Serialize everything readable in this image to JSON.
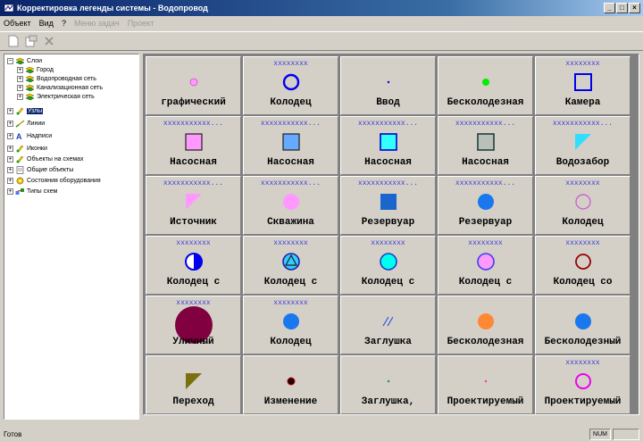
{
  "window": {
    "title": "Корректировка легенды системы - Водопровод",
    "minimize": "_",
    "maximize": "□",
    "close": "×"
  },
  "menu": [
    {
      "label": "Объект",
      "disabled": false
    },
    {
      "label": "Вид",
      "disabled": false
    },
    {
      "label": "?",
      "disabled": false
    },
    {
      "label": "Меню задач",
      "disabled": true
    },
    {
      "label": "Проект",
      "disabled": true
    }
  ],
  "tree": [
    {
      "label": "Слои",
      "level": 0,
      "expander": "−",
      "icon": "layer-icon"
    },
    {
      "label": "Город",
      "level": 1,
      "expander": "+",
      "icon": "layer-icon"
    },
    {
      "label": "Водопроводная сеть",
      "level": 1,
      "expander": "+",
      "icon": "layer-icon"
    },
    {
      "label": "Канализационная сеть",
      "level": 1,
      "expander": "+",
      "icon": "layer-icon"
    },
    {
      "label": "Электрическая сеть",
      "level": 1,
      "expander": "+",
      "icon": "layer-icon"
    },
    {
      "label": "Узлы",
      "level": 0,
      "expander": "+",
      "icon": "node-icon",
      "selected": true
    },
    {
      "label": "Линии",
      "level": 0,
      "expander": "+",
      "icon": "line-icon"
    },
    {
      "label": "Надписи",
      "level": 0,
      "expander": "+",
      "icon": "text-icon"
    },
    {
      "label": "Иконки",
      "level": 0,
      "expander": "+",
      "icon": "node-icon"
    },
    {
      "label": "Объекты на схемах",
      "level": 0,
      "expander": "+",
      "icon": "node-icon"
    },
    {
      "label": "Общие объекты",
      "level": 0,
      "expander": "+",
      "icon": "document-icon"
    },
    {
      "label": "Состояния оборудования",
      "level": 0,
      "expander": "+",
      "icon": "gear-icon"
    },
    {
      "label": "Типы схем",
      "level": 0,
      "expander": "+",
      "icon": "scheme-icon"
    }
  ],
  "tiles": [
    {
      "top": "",
      "label": "графический",
      "symbol": "small-pink-circle"
    },
    {
      "top": "xxxxxxxx",
      "label": "Колодец",
      "symbol": "blue-ring"
    },
    {
      "top": "",
      "label": "Ввод",
      "symbol": "tiny-blue-dot"
    },
    {
      "top": "",
      "label": "Бесколодезная",
      "symbol": "green-dot"
    },
    {
      "top": "xxxxxxxx",
      "label": "Камера",
      "symbol": "blue-square-outline"
    },
    {
      "top": "xxxxxxxxxxx...",
      "label": "Насосная",
      "symbol": "pink-square"
    },
    {
      "top": "xxxxxxxxxxx...",
      "label": "Насосная",
      "symbol": "lightblue-square"
    },
    {
      "top": "xxxxxxxxxxx...",
      "label": "Насосная",
      "symbol": "cyan-square"
    },
    {
      "top": "xxxxxxxxxxx...",
      "label": "Насосная",
      "symbol": "teal-square"
    },
    {
      "top": "xxxxxxxxxxx...",
      "label": "Водозабор",
      "symbol": "cyan-triangle"
    },
    {
      "top": "xxxxxxxxxxx...",
      "label": "Источник",
      "symbol": "pink-triangle"
    },
    {
      "top": "xxxxxxxxxxx...",
      "label": "Скважина",
      "symbol": "pink-circle"
    },
    {
      "top": "xxxxxxxxxxx...",
      "label": "Резервуар",
      "symbol": "blue-square-solid"
    },
    {
      "top": "xxxxxxxxxxx...",
      "label": "Резервуар",
      "symbol": "blue-circle"
    },
    {
      "top": "xxxxxxxx",
      "label": "Колодец",
      "symbol": "pink-ring"
    },
    {
      "top": "xxxxxxxx",
      "label": "Колодец с",
      "symbol": "half-blue-circle"
    },
    {
      "top": "xxxxxxxx",
      "label": "Колодец с",
      "symbol": "circle-with-triangle"
    },
    {
      "top": "xxxxxxxx",
      "label": "Колодец с",
      "symbol": "cyan-circle"
    },
    {
      "top": "xxxxxxxx",
      "label": "Колодец с",
      "symbol": "pink-circle-blue-edge"
    },
    {
      "top": "xxxxxxxx",
      "label": "Колодец со",
      "symbol": "darkred-ring"
    },
    {
      "top": "xxxxxxxx",
      "label": "Уличный",
      "symbol": "big-maroon-circle"
    },
    {
      "top": "xxxxxxxx",
      "label": "Колодец",
      "symbol": "blue-circle"
    },
    {
      "top": "",
      "label": "Заглушка",
      "symbol": "double-slash"
    },
    {
      "top": "",
      "label": "Бесколодезная",
      "symbol": "orange-circle"
    },
    {
      "top": "",
      "label": "Бесколодезный",
      "symbol": "blue-circle"
    },
    {
      "top": "",
      "label": "Переход",
      "symbol": "olive-triangle"
    },
    {
      "top": "",
      "label": "Изменение",
      "symbol": "black-red-dot"
    },
    {
      "top": "",
      "label": "Заглушка,",
      "symbol": "tiny-teal-dot"
    },
    {
      "top": "",
      "label": "Проектируемый",
      "symbol": "tiny-pink-dot"
    },
    {
      "top": "xxxxxxxx",
      "label": "Проектируемый",
      "symbol": "magenta-ring"
    }
  ],
  "status": {
    "text": "Готов",
    "num": "NUM"
  }
}
